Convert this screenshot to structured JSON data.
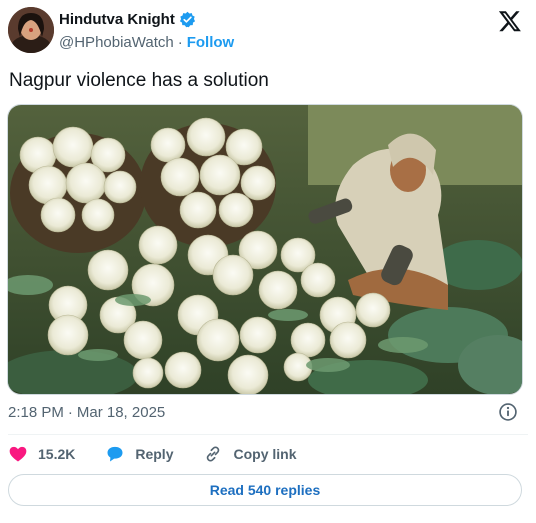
{
  "author": {
    "display_name": "Hindutva Knight",
    "handle": "@HPhobiaWatch",
    "separator": "·",
    "follow_label": "Follow",
    "verified": true
  },
  "tweet": {
    "text": "Nagpur violence has a solution",
    "time": "2:18 PM",
    "time_separator": "·",
    "date": "Mar 18, 2025"
  },
  "actions": {
    "likes_count": "15.2K",
    "reply_label": "Reply",
    "copy_link_label": "Copy link"
  },
  "replies_button": {
    "label": "Read 540 replies"
  },
  "colors": {
    "accent": "#1d9bf0",
    "like": "#f91880",
    "muted": "#536471"
  },
  "icons": [
    "verified-badge-icon",
    "x-logo-icon",
    "info-icon",
    "heart-icon",
    "reply-bubble-icon",
    "link-icon"
  ]
}
